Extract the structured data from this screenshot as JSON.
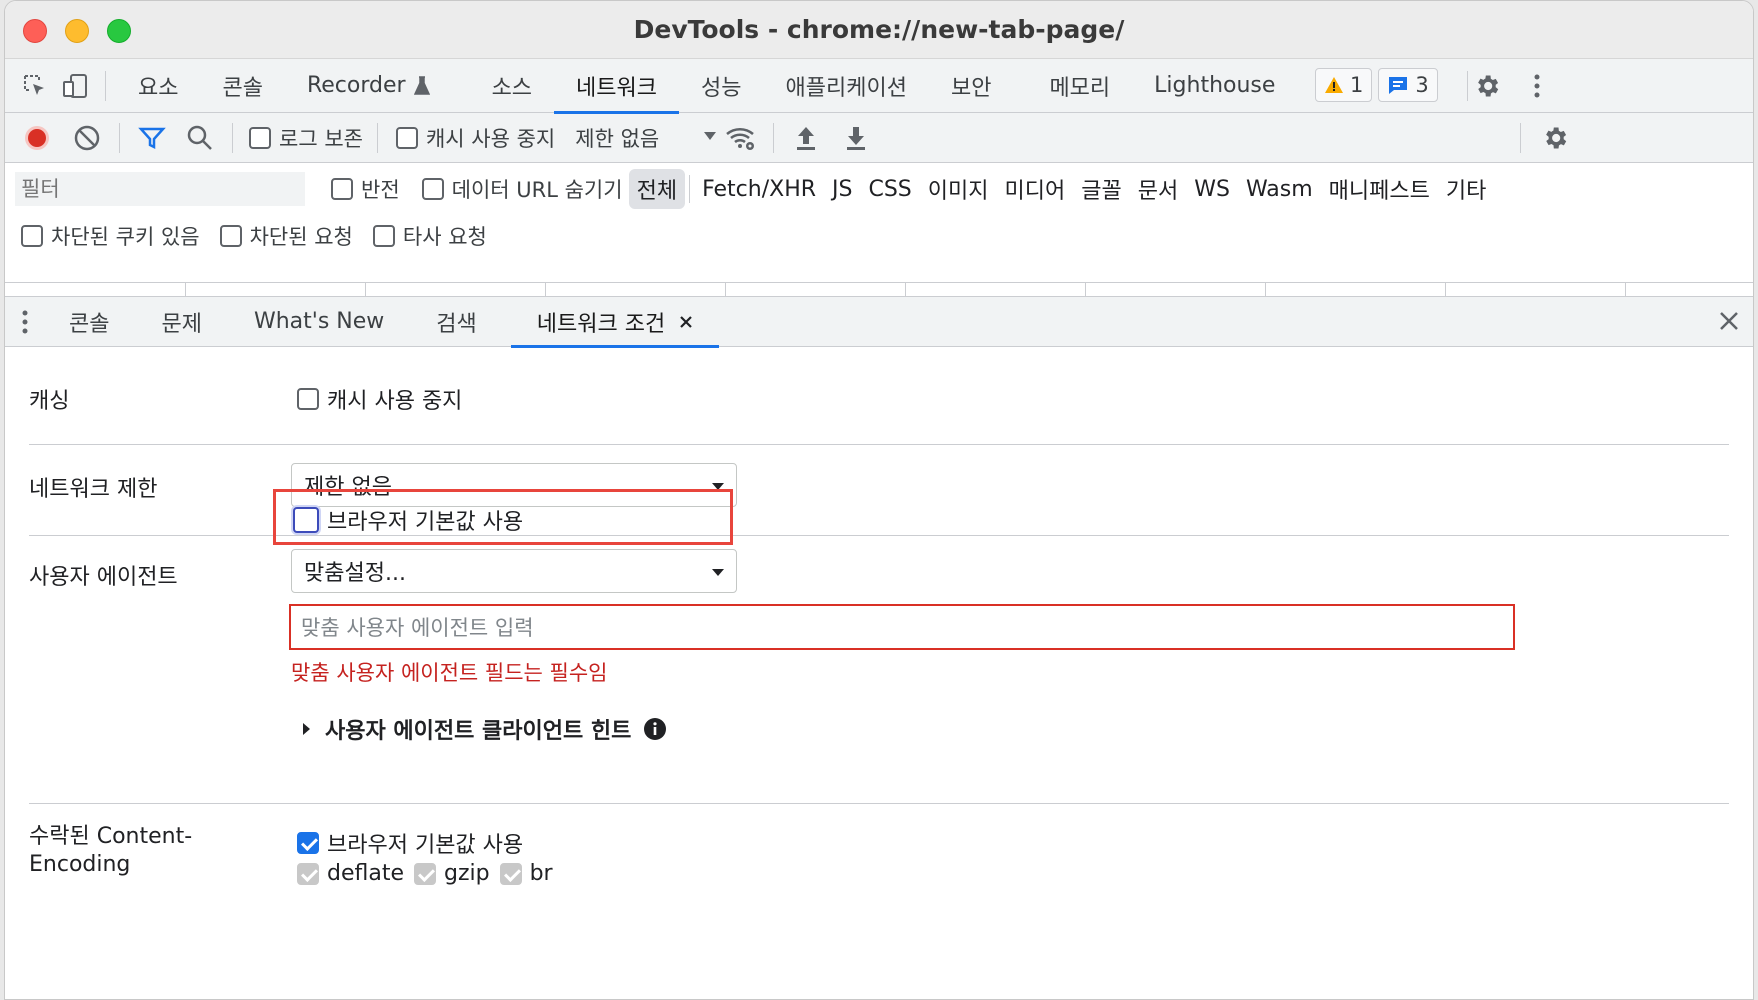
{
  "window": {
    "title": "DevTools - chrome://new-tab-page/"
  },
  "main_tabs": [
    "요소",
    "콘솔",
    "Recorder",
    "소스",
    "네트워크",
    "성능",
    "애플리케이션",
    "보안",
    "메모리",
    "Lighthouse"
  ],
  "main_tab_active": "네트워크",
  "badges": {
    "warnings": "1",
    "messages": "3"
  },
  "network_toolbar": {
    "preserve_log": "로그 보존",
    "disable_cache": "캐시 사용 중지",
    "throttle": "제한 없음"
  },
  "filter": {
    "placeholder": "필터",
    "invert": "반전",
    "hide_data_urls": "데이터 URL 숨기기",
    "types": [
      "전체",
      "Fetch/XHR",
      "JS",
      "CSS",
      "이미지",
      "미디어",
      "글꼴",
      "문서",
      "WS",
      "Wasm",
      "매니페스트",
      "기타"
    ],
    "active_type": "전체",
    "blocked_cookies": "차단된 쿠키 있음",
    "blocked_requests": "차단된 요청",
    "third_party": "타사 요청"
  },
  "drawer_tabs": [
    "콘솔",
    "문제",
    "What's New",
    "검색",
    "네트워크 조건"
  ],
  "drawer_active": "네트워크 조건",
  "conditions": {
    "caching_label": "캐싱",
    "caching_checkbox": "캐시 사용 중지",
    "throttling_label": "네트워크 제한",
    "throttling_value": "제한 없음",
    "ua_label": "사용자 에이전트",
    "ua_browser_default": "브라우저 기본값 사용",
    "ua_select": "맞춤설정...",
    "ua_input_placeholder": "맞춤 사용자 에이전트 입력",
    "ua_error": "맞춤 사용자 에이전트 필드는 필수임",
    "ua_client_hints": "사용자 에이전트 클라이언트 힌트",
    "encoding_label_1": "수락된 Content-",
    "encoding_label_2": "Encoding",
    "encoding_browser_default": "브라우저 기본값 사용",
    "encodings": [
      "deflate",
      "gzip",
      "br"
    ]
  },
  "colors": {
    "accent": "#1a73e8",
    "error": "#d93025",
    "highlight": "#e8453c",
    "record": "#d93025"
  },
  "icons": [
    "inspect-icon",
    "device-toggle-icon",
    "flask-icon",
    "warning-icon",
    "message-icon",
    "gear-icon",
    "more-vert-icon",
    "record-icon",
    "clear-icon",
    "filter-icon",
    "search-icon",
    "caret-down-icon",
    "wifi-settings-icon",
    "upload-icon",
    "download-icon",
    "close-icon",
    "expand-arrow-icon",
    "info-icon"
  ]
}
